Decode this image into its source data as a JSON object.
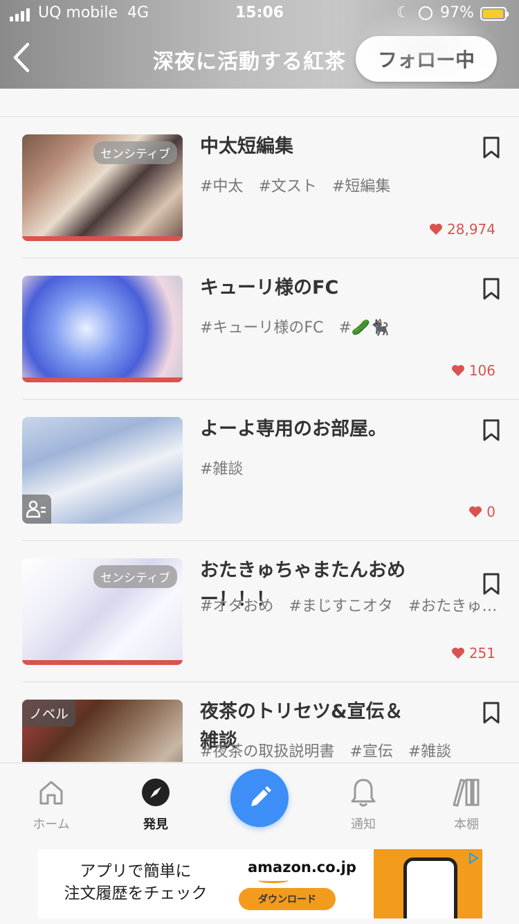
{
  "status_bar": {
    "carrier": "UQ mobile",
    "network": "4G",
    "time": "15:06",
    "battery": "97%",
    "battery_level": 0.97
  },
  "header": {
    "title": "深夜に活動する紅茶",
    "follow_label": "フォロー中"
  },
  "items": [
    {
      "title": "中太短編集",
      "badge": "センシティブ",
      "tags": [
        "#中太",
        "#文スト",
        "#短編集"
      ],
      "likes": "28,974"
    },
    {
      "title": "キューリ様のFC",
      "badge": "",
      "tags": [
        "#キューリ様のFC",
        "#🥒🐈‍⬛"
      ],
      "likes": "106"
    },
    {
      "title": "よーよ専用のお部屋。",
      "badge": "",
      "tags": [
        "#雑談"
      ],
      "likes": "0"
    },
    {
      "title": "おたきゅちゃまたんおめー！！！",
      "badge": "センシティブ",
      "tags": [
        "#オタおめ",
        "#まじすこオタ",
        "#おたきゅ…"
      ],
      "likes": "251"
    },
    {
      "title": "夜茶のトリセツ&宣伝＆雑談",
      "badge": "ノベル",
      "tags": [
        "#夜茶の取扱説明書",
        "#宣伝",
        "#雑談"
      ],
      "likes": ""
    }
  ],
  "nav": {
    "home": "ホーム",
    "discover": "発見",
    "notify": "通知",
    "shelf": "本棚"
  },
  "ad": {
    "line1": "アプリで簡単に",
    "line2": "注文履歴をチェック",
    "brand": "amazon.co.jp",
    "cta": "ダウンロード"
  },
  "colors": {
    "accent_blue": "#3d8ef7",
    "like_red": "#d9534f",
    "amazon_orange": "#f29b1c"
  }
}
